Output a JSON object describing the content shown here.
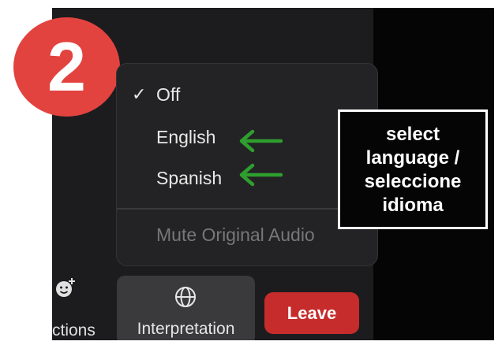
{
  "step_badge": "2",
  "menu": {
    "items": [
      {
        "label": "Off",
        "checked": true
      },
      {
        "label": "English",
        "checked": false
      },
      {
        "label": "Spanish",
        "checked": false
      }
    ],
    "mute_label": "Mute Original Audio",
    "check_glyph": "✓"
  },
  "callout": {
    "text": "select language / seleccione idioma"
  },
  "toolbar": {
    "reactions_label": "ctions",
    "interpretation_label": "Interpretation",
    "leave_label": "Leave"
  },
  "colors": {
    "badge": "#e2433f",
    "arrow": "#2e9e2e",
    "leave": "#c62c2c"
  },
  "icons": [
    "smiley-plus-icon",
    "globe-icon",
    "checkmark-icon",
    "arrow-left-icon"
  ]
}
